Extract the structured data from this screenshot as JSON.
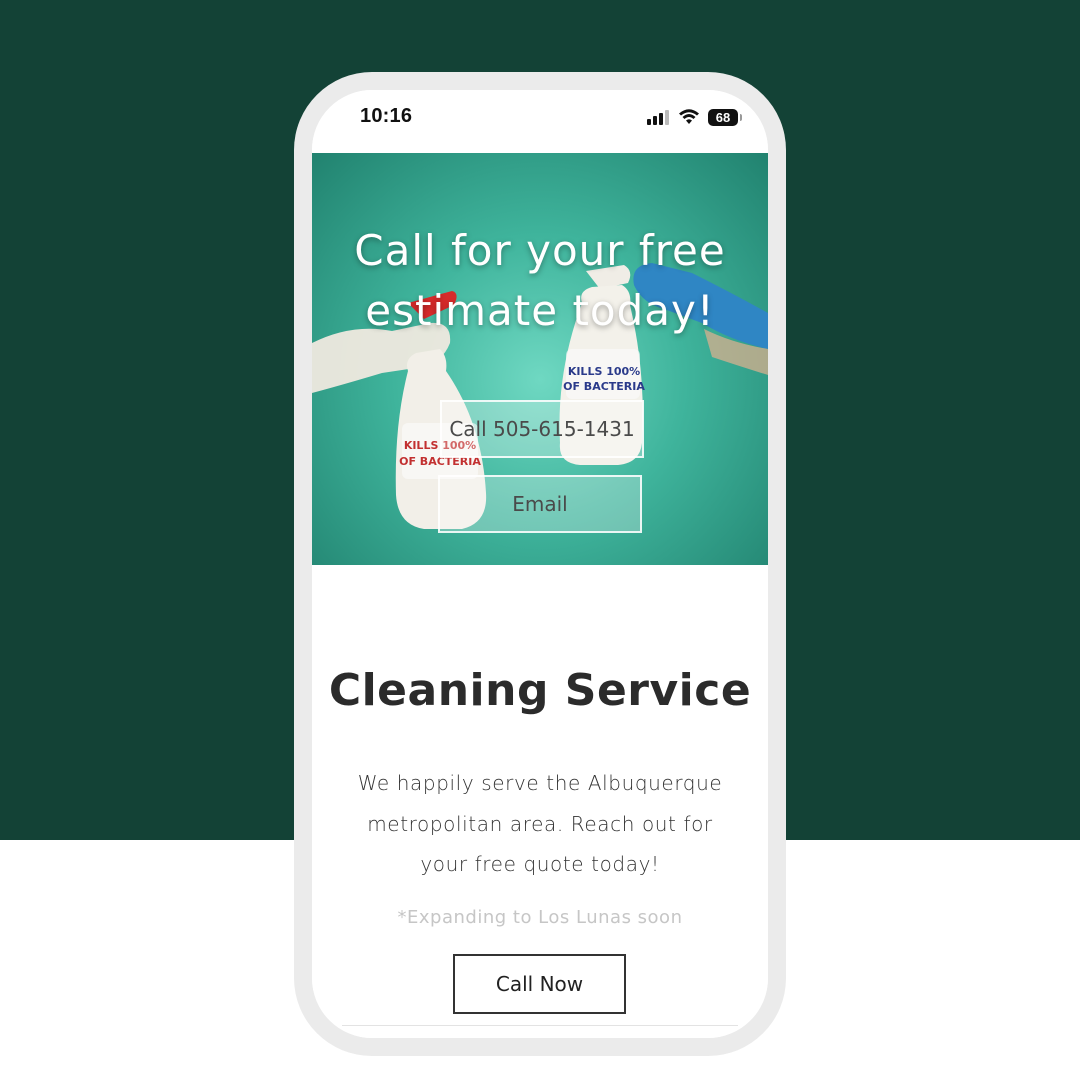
{
  "status_bar": {
    "time": "10:16",
    "battery": "68",
    "icons": [
      "signal-icon",
      "wifi-icon",
      "battery-icon"
    ]
  },
  "hero": {
    "title": "Call for your free estimate today!",
    "call_button": "Call 505-615-1431",
    "email_button": "Email",
    "image_text_left": "KILLS 100% OF BACTERIA",
    "image_text_right": "KILLS 100% OF BACTERIA"
  },
  "section": {
    "title": "Cleaning Service",
    "body": "We happily serve the Albuquerque metropolitan  area. Reach out for your free quote today!",
    "note": "*Expanding to Los Lunas soon",
    "cta": "Call Now"
  },
  "colors": {
    "background": "#134236",
    "hero_teal": "#3fb49c",
    "text_dark": "#2b2b2b",
    "note_gray": "#c6c6c6"
  }
}
